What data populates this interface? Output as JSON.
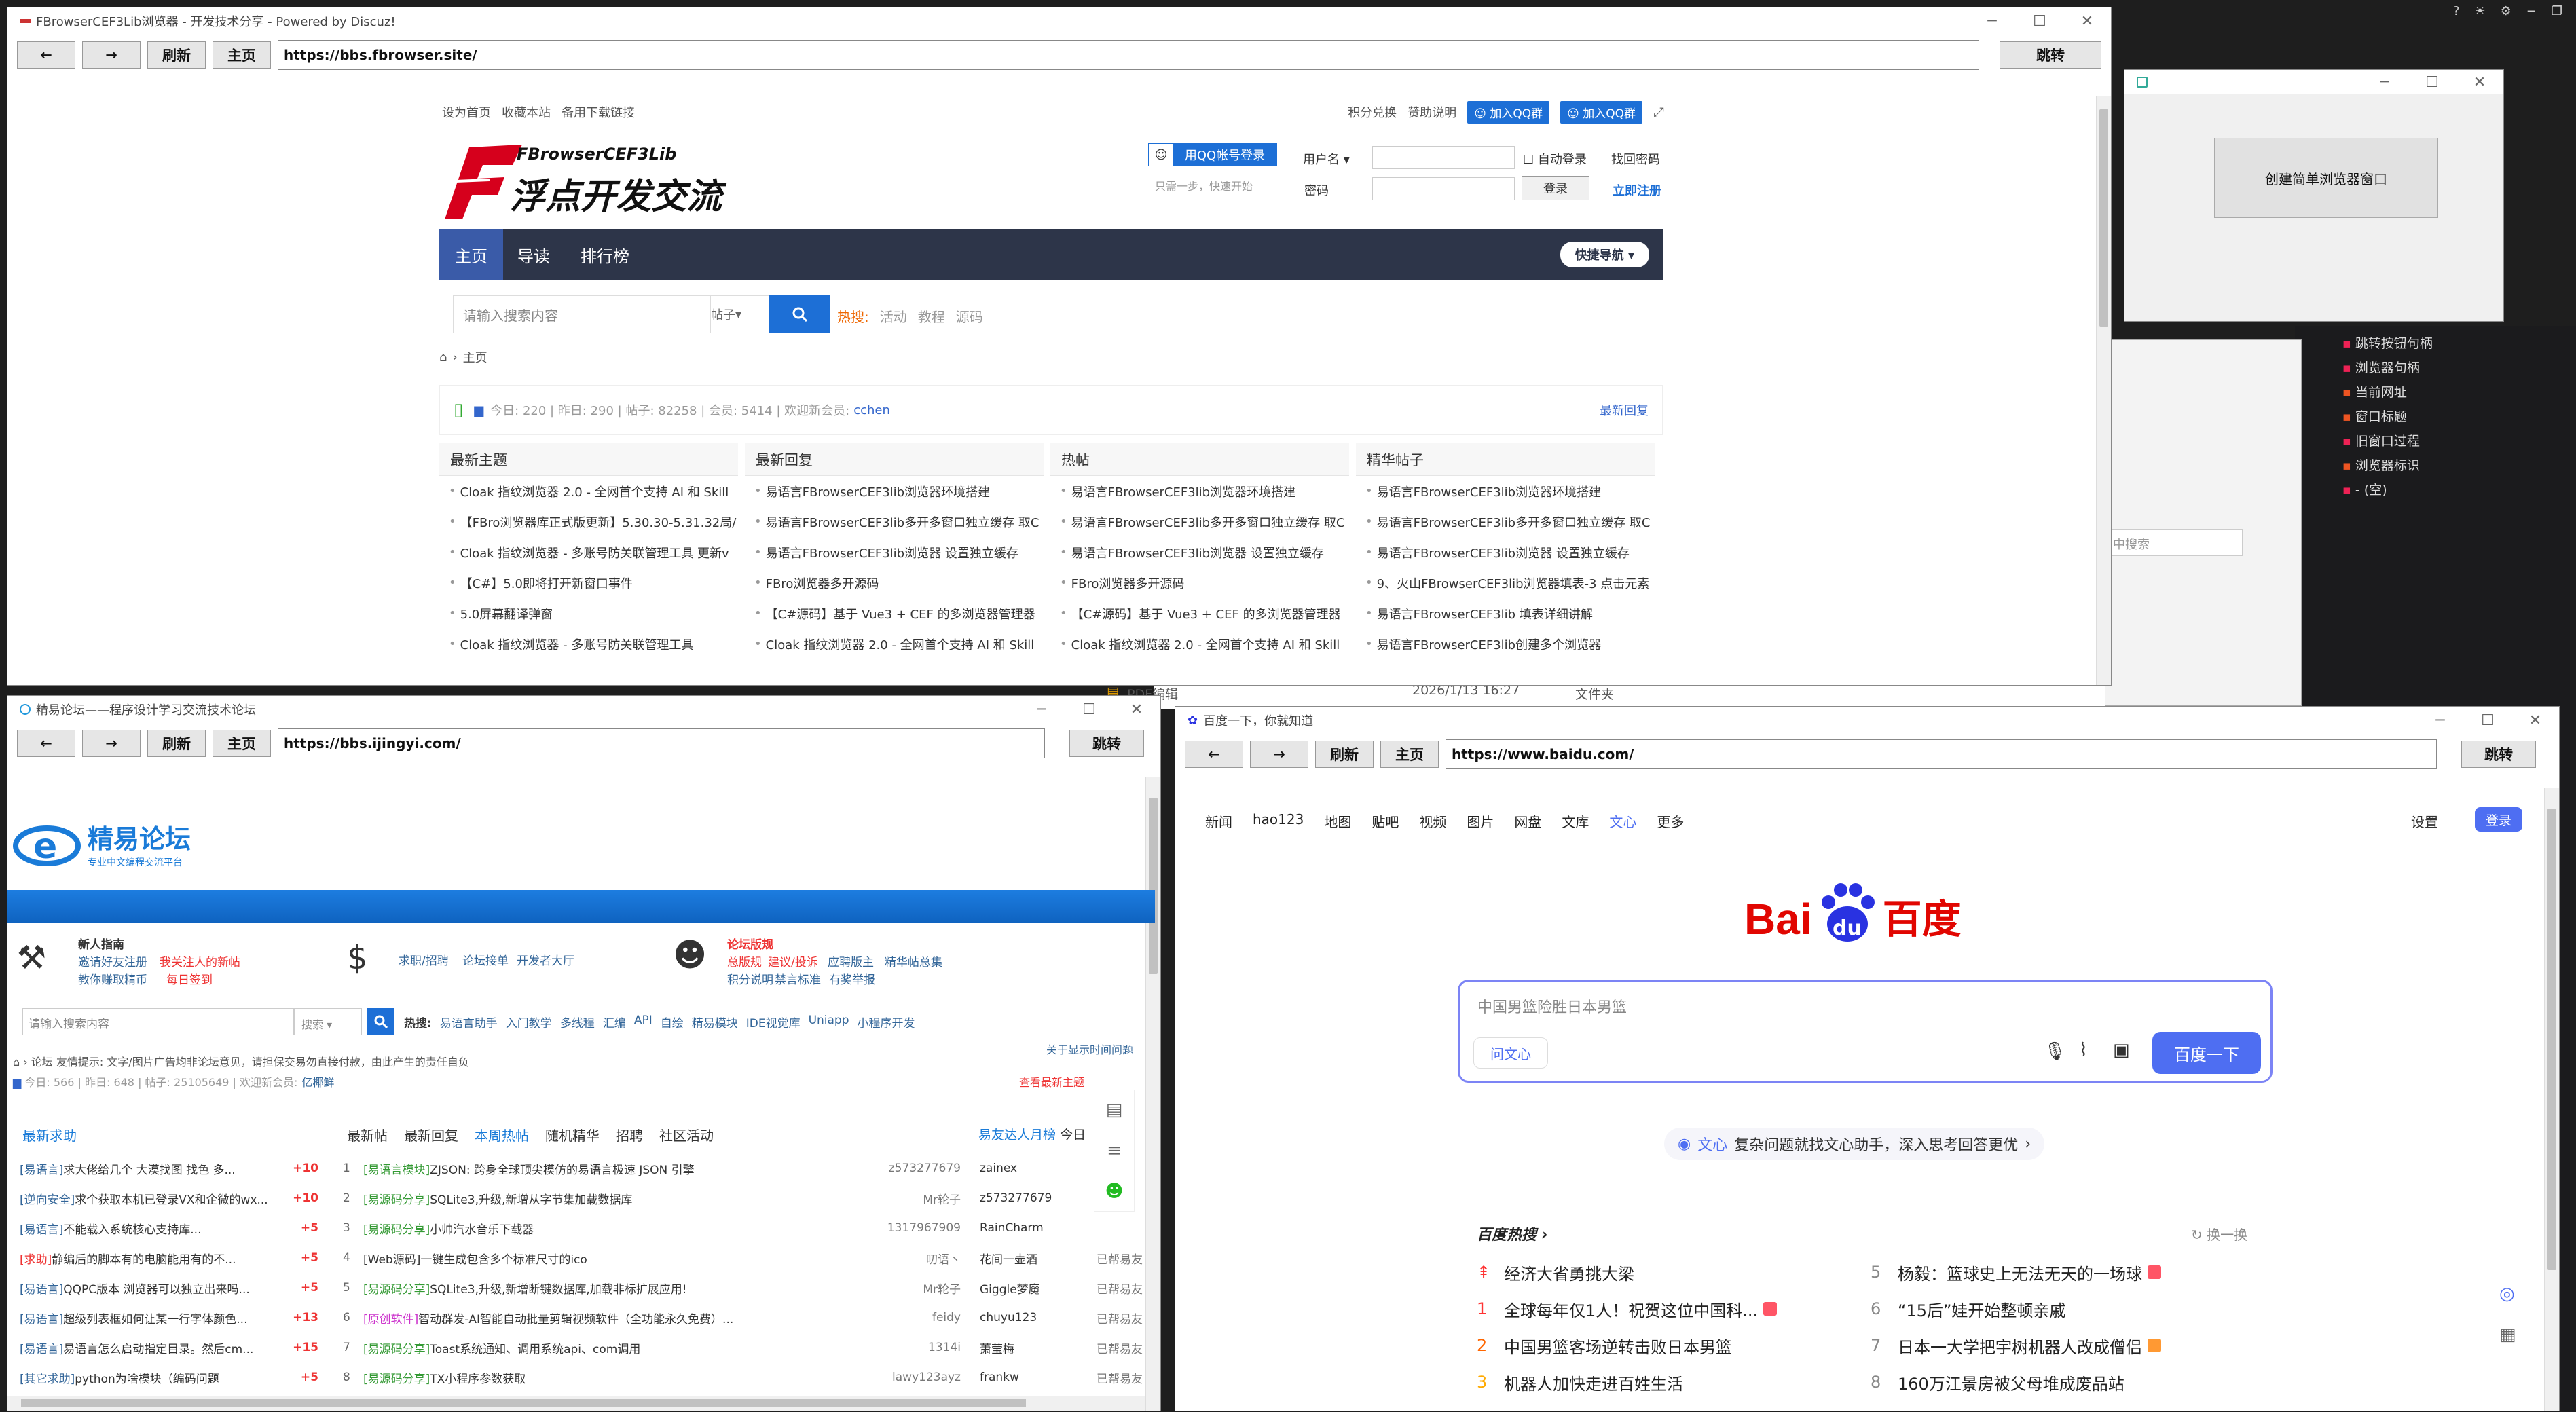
{
  "taskbar_icons": [
    "?",
    "☀",
    "⚙",
    "−",
    "❐"
  ],
  "fb": {
    "title": "FBrowserCEF3Lib浏览器 - 开发技术分享 - Powered by Discuz!",
    "nav": {
      "back": "←",
      "fwd": "→",
      "refresh": "刷新",
      "home": "主页",
      "url": "https://bbs.fbrowser.site/",
      "go": "跳转"
    },
    "top_left": [
      "设为首页",
      "收藏本站",
      "备用下载链接"
    ],
    "top_right": [
      "积分兑换",
      "赞助说明"
    ],
    "qq_group": "加入QQ群",
    "logo_small": "FBrowserCEF3Lib",
    "logo_big": "浮点开发交流",
    "qq_login": "用QQ帐号登录",
    "qq_hint": "只需一步，快速开始",
    "user_label": "用户名",
    "auto_login": "自动登录",
    "find_pwd": "找回密码",
    "pwd_label": "密码",
    "login": "登录",
    "register": "立即注册",
    "tabs": [
      "主页",
      "导读",
      "排行榜"
    ],
    "quick_nav": "快捷导航",
    "search_placeholder": "请输入搜索内容",
    "search_type": "帖子",
    "hot_label": "热搜:",
    "hot_tags": [
      "活动",
      "教程",
      "源码"
    ],
    "breadcrumb": "主页",
    "stats": "今日: 220 | 昨日: 290 | 帖子: 82258 | 会员: 5414 | 欢迎新会员:",
    "new_member": "cchen",
    "latest_reply_link": "最新回复",
    "cols": [
      {
        "title": "最新主题",
        "items": [
          "Cloak 指纹浏览器 2.0 - 全网首个支持 AI 和 Skill",
          "【FBro浏览器库正式版更新】5.30.30-5.31.32局/",
          "Cloak 指纹浏览器 - 多账号防关联管理工具 更新v",
          "【C#】5.0即将打开新窗口事件",
          "5.0屏幕翻译弹窗",
          "Cloak 指纹浏览器 - 多账号防关联管理工具"
        ]
      },
      {
        "title": "最新回复",
        "items": [
          "易语言FBrowserCEF3lib浏览器环境搭建",
          "易语言FBrowserCEF3lib多开多窗口独立缓存 取C",
          "易语言FBrowserCEF3lib浏览器 设置独立缓存",
          "FBro浏览器多开源码",
          "【C#源码】基于 Vue3 + CEF 的多浏览器管理器",
          "Cloak 指纹浏览器 2.0 - 全网首个支持 AI 和 Skill"
        ]
      },
      {
        "title": "热帖",
        "items": [
          "易语言FBrowserCEF3lib浏览器环境搭建",
          "易语言FBrowserCEF3lib多开多窗口独立缓存 取C",
          "易语言FBrowserCEF3lib浏览器 设置独立缓存",
          "FBro浏览器多开源码",
          "【C#源码】基于 Vue3 + CEF 的多浏览器管理器",
          "Cloak 指纹浏览器 2.0 - 全网首个支持 AI 和 Skill"
        ]
      },
      {
        "title": "精华帖子",
        "items": [
          "易语言FBrowserCEF3lib浏览器环境搭建",
          "易语言FBrowserCEF3lib多开多窗口独立缓存 取C",
          "易语言FBrowserCEF3lib浏览器 设置独立缓存",
          "9、火山FBrowserCEF3lib浏览器填表-3 点击元素",
          "易语言FBrowserCEF3lib 填表详细讲解",
          "易语言FBrowserCEF3lib创建多个浏览器"
        ]
      }
    ]
  },
  "small": {
    "btn": "创建简单浏览器窗口"
  },
  "side": {
    "items": [
      "跳转按钮句柄",
      "浏览器句柄",
      "当前网址",
      "窗口标题",
      "旧窗口过程",
      "浏览器标识",
      "- (空)"
    ],
    "search": "中搜索"
  },
  "behind": {
    "date": "2026/1/13 16:27",
    "folder": "文件夹",
    "pdf": "PDF编辑"
  },
  "jy": {
    "title": "精易论坛——程序设计学习交流技术论坛",
    "nav": {
      "back": "←",
      "fwd": "→",
      "refresh": "刷新",
      "home": "主页",
      "url": "https://bbs.ijingyi.com/",
      "go": "跳转"
    },
    "logo": "精易论坛",
    "slogan": "专业中文编程交流平台",
    "g1_title": "新人指南",
    "g1_a": "邀请好友注册",
    "g1_b": "我关注人的新帖",
    "g1_c": "教你赚取精币",
    "g1_d": "每日签到",
    "g2_a": "求职/招聘",
    "g2_b": "论坛接单",
    "g2_c": "开发者大厅",
    "g3_title": "论坛版规",
    "g3_a": "总版规",
    "g3_b": "建议/投诉",
    "g3_c": "应聘版主",
    "g3_d": "精华帖总集",
    "g3_e": "积分说明",
    "g3_f": "禁言标准",
    "g3_g": "有奖举报",
    "search_placeholder": "请输入搜索内容",
    "search_type": "搜索",
    "hot_label": "热搜:",
    "hot": [
      "易语言助手",
      "入门教学",
      "多线程",
      "汇编",
      "API",
      "自绘",
      "精易模块",
      "IDE视觉库",
      "Uniapp",
      "小程序开发"
    ],
    "notice": "论坛   友情提示: 文字/图片广告均非论坛意见，请担保交易勿直接付款，由此产生的责任自负",
    "stats": "今日: 566 | 昨日: 648 | 帖子: 25105649 | 欢迎新会员:",
    "new_member": "亿椰鲜",
    "right_link1": "关于显示时间问题",
    "right_link2": "查看最新主题",
    "help_title": "最新求助",
    "help": [
      {
        "tag": "[易语言]",
        "text": "求大佬给几个 大漠找图 找色 多...",
        "pts": "+10"
      },
      {
        "tag": "[逆向安全]",
        "text": "求个获取本机已登录VX和企微的wx...",
        "pts": "+10"
      },
      {
        "tag": "[易语言]",
        "text": "不能载入系统核心支持库...",
        "pts": "+5"
      },
      {
        "tag": "[求助]",
        "text": "静编后的脚本有的电脑能用有的不...",
        "pts": "+5"
      },
      {
        "tag": "[易语言]",
        "text": "QQPC版本 浏览器可以独立出来吗...",
        "pts": "+5"
      },
      {
        "tag": "[易语言]",
        "text": "超级列表框如何让某一行字体颜色...",
        "pts": "+13"
      },
      {
        "tag": "[易语言]",
        "text": "易语言怎么启动指定目录。然后cm...",
        "pts": "+15"
      },
      {
        "tag": "[其它求助]",
        "text": "python为啥模块（编码问题",
        "pts": "+5"
      }
    ],
    "tabs": [
      "最新帖",
      "最新回复",
      "本周热帖",
      "随机精华",
      "招聘",
      "社区活动"
    ],
    "posts": [
      {
        "n": "1",
        "tag": "[易语言模块]",
        "text": "ZJSON: 跨身全球顶尖模仿的易语言极速 JSON 引擎",
        "user": "z573277679"
      },
      {
        "n": "2",
        "tag": "[易源码分享]",
        "text": "SQLite3,升级,新增从字节集加载数据库",
        "user": "Mr轮子"
      },
      {
        "n": "3",
        "tag": "[易源码分享]",
        "text": "小帅汽水音乐下载器",
        "user": "1317967909"
      },
      {
        "n": "4",
        "tag": "[Web源码]",
        "text": "一键生成包含多个标准尺寸的ico",
        "user": "叨语丶"
      },
      {
        "n": "5",
        "tag": "[易源码分享]",
        "text": "SQLite3,升级,新增断键数据库,加载非标扩展应用!",
        "user": "Mr轮子"
      },
      {
        "n": "6",
        "tag": "[原创软件]",
        "text": "智动群发-AI智能自动批量剪辑视频软件（全功能永久免费）...",
        "user": "feidy"
      },
      {
        "n": "7",
        "tag": "[易源码分享]",
        "text": "Toast系统通知、调用系统api、com调用",
        "user": "1314i"
      },
      {
        "n": "8",
        "tag": "[易源码分享]",
        "text": "TX小程序参数获取",
        "user": "lawy123ayz"
      }
    ],
    "rank_title": "易友达人月榜",
    "rank_title2": "今日",
    "rank": [
      "zainex",
      "z573277679",
      "RainCharm",
      "花间一壶酒",
      "Giggle梦魔",
      "chuyu123",
      "萧莹梅",
      "frankw"
    ],
    "rank_extra": [
      "",
      "",
      "",
      "已帮易友",
      "已帮易友",
      "已帮易友",
      "已帮易友",
      "已帮易友"
    ]
  },
  "bd": {
    "title": "百度一下，你就知道",
    "nav": {
      "back": "←",
      "fwd": "→",
      "refresh": "刷新",
      "home": "主页",
      "url": "https://www.baidu.com/",
      "go": "跳转"
    },
    "top": [
      "新闻",
      "hao123",
      "地图",
      "贴吧",
      "视频",
      "图片",
      "网盘",
      "文库",
      "文心",
      "更多"
    ],
    "settings": "设置",
    "login": "登录",
    "logo_a": "Bai",
    "logo_b": "百度",
    "query": "中国男篮险胜日本男篮",
    "wenxin": "问文心",
    "submit": "百度一下",
    "banner_tag": "文心",
    "banner": "复杂问题就找文心助手，深入思考回答更优",
    "hot_title": "百度热搜",
    "refresh": "换一换",
    "hot_left": [
      {
        "n": "",
        "t": "经济大省勇挑大梁"
      },
      {
        "n": "1",
        "t": "全球每年仅1人！祝贺这位中国科..."
      },
      {
        "n": "2",
        "t": "中国男篮客场逆转击败日本男篮"
      },
      {
        "n": "3",
        "t": "机器人加快走进百姓生活"
      }
    ],
    "hot_right": [
      {
        "n": "5",
        "t": "杨毅：篮球史上无法无天的一场球"
      },
      {
        "n": "6",
        "t": "“15后”娃开始整顿亲戚"
      },
      {
        "n": "7",
        "t": "日本一大学把宇树机器人改成僧侣"
      },
      {
        "n": "8",
        "t": "160万江景房被父母堆成废品站"
      }
    ]
  }
}
